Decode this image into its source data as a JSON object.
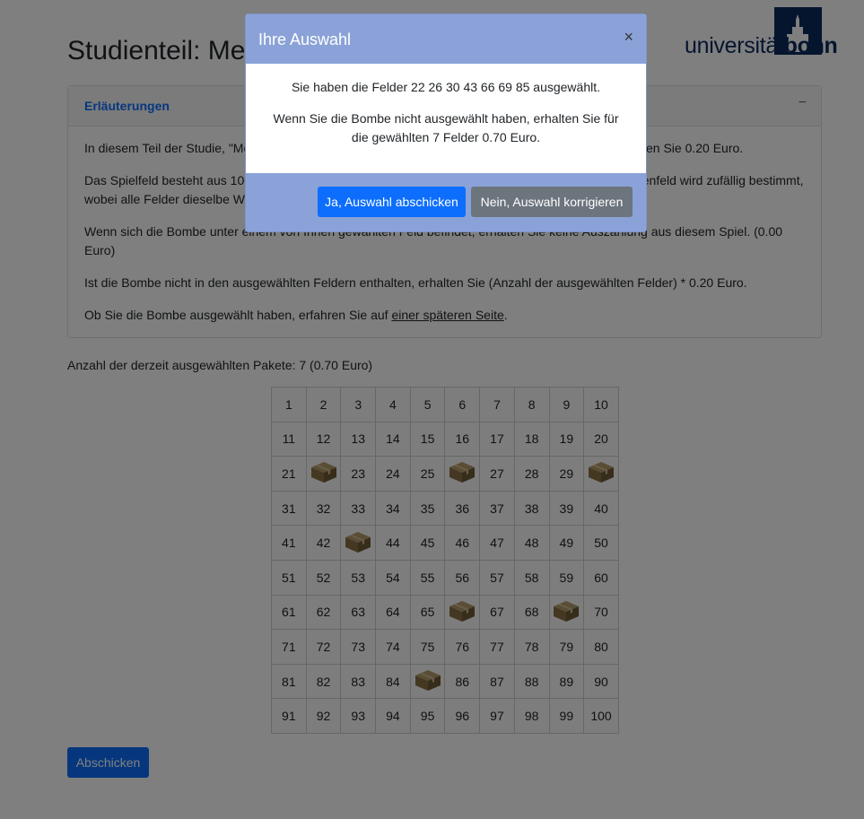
{
  "page": {
    "title": "Studienteil: Meine Auswahl"
  },
  "logo": {
    "text_regular": "universität",
    "text_bold": "bonn"
  },
  "explanation": {
    "header": "Erläuterungen",
    "toggle": "−",
    "paragraphs": [
      "In diesem Teil der Studie, \"Meine Auswahl\", sammeln Sie Pakete. Für jedes gesammelte Paket erhalten Sie 0.20 Euro.",
      "Das Spielfeld besteht aus 100 Feldern. Hinter einem der Felder ist eine Bombe versteckt. Das Bombenfeld wird zufällig bestimmt, wobei alle Felder dieselbe Wahrscheinlichkeit haben.",
      "Wenn sich die Bombe unter einem von Ihnen gewählten Feld befindet, erhalten Sie keine Auszahlung aus diesem Spiel. (0.00 Euro)",
      "Ist die Bombe nicht in den ausgewählten Feldern enthalten, erhalten Sie (Anzahl der ausgewählten Felder) * 0.20 Euro."
    ],
    "last_paragraph_prefix": "Ob Sie die Bombe ausgewählt haben, erfahren Sie auf ",
    "last_paragraph_link": "einer späteren Seite",
    "last_paragraph_suffix": "."
  },
  "selection": {
    "count_text": "Anzahl der derzeit ausgewählten Pakete: 7 (0.70 Euro)",
    "selected_fields": [
      22,
      26,
      30,
      43,
      66,
      69,
      85
    ],
    "box_icon": "package-box-icon"
  },
  "submit": {
    "label": "Abschicken"
  },
  "modal": {
    "title": "Ihre Auswahl",
    "close": "×",
    "line1": "Sie haben die Felder 22 26 30 43 66 69 85 ausgewählt.",
    "line2": "Wenn Sie die Bombe nicht ausgewählt haben, erhalten Sie für die gewählten 7 Felder 0.70 Euro.",
    "confirm_label": "Ja, Auswahl abschicken",
    "correct_label": "Nein, Auswahl korrigieren"
  },
  "colors": {
    "primary": "#0d6efd",
    "secondary": "#6c757d",
    "modal_band": "#8aa2d7",
    "logo": "#0b2a5c"
  }
}
